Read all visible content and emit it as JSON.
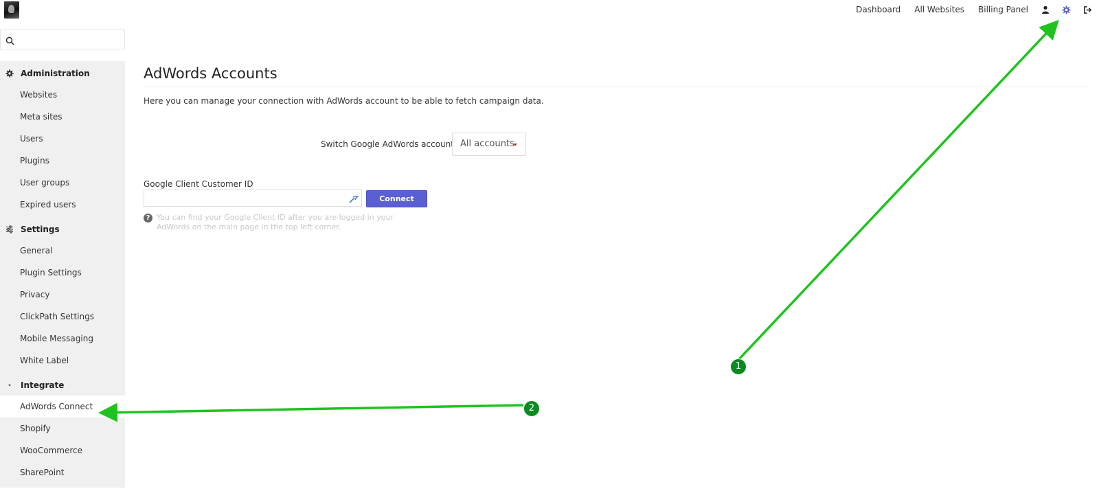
{
  "topnav": {
    "links": [
      "Dashboard",
      "All Websites",
      "Billing Panel"
    ],
    "icons": [
      "user-icon",
      "gear-icon",
      "logout-icon"
    ],
    "active_icon_color": "#5b5fd4"
  },
  "sidebar": {
    "search": {
      "value": "",
      "placeholder": ""
    },
    "sections": [
      {
        "label": "Administration",
        "icon": "gear-icon",
        "items": [
          "Websites",
          "Meta sites",
          "Users",
          "Plugins",
          "User groups",
          "Expired users"
        ]
      },
      {
        "label": "Settings",
        "icon": "sliders-icon",
        "items": [
          "General",
          "Plugin Settings",
          "Privacy",
          "ClickPath Settings",
          "Mobile Messaging",
          "White Label"
        ]
      },
      {
        "label": "Integrate",
        "icon": "caret-down-icon",
        "items": [
          "AdWords Connect",
          "Shopify",
          "WooCommerce",
          "SharePoint"
        ],
        "active": "AdWords Connect"
      }
    ]
  },
  "main": {
    "title": "AdWords Accounts",
    "intro": "Here you can manage your connection with AdWords account to be able to fetch campaign data.",
    "switch_label": "Switch Google AdWords account:",
    "switch_value": "All accounts",
    "cid_label": "Google Client Customer ID",
    "cid_value": "",
    "connect_label": "Connect",
    "help_text": "You can find your Google Client ID after you are logged in your AdWords on the main page in the top left corner."
  },
  "annotations": {
    "color": "#1ec31e",
    "badge_color": "#0b8a22",
    "badges": [
      "1",
      "2"
    ]
  }
}
